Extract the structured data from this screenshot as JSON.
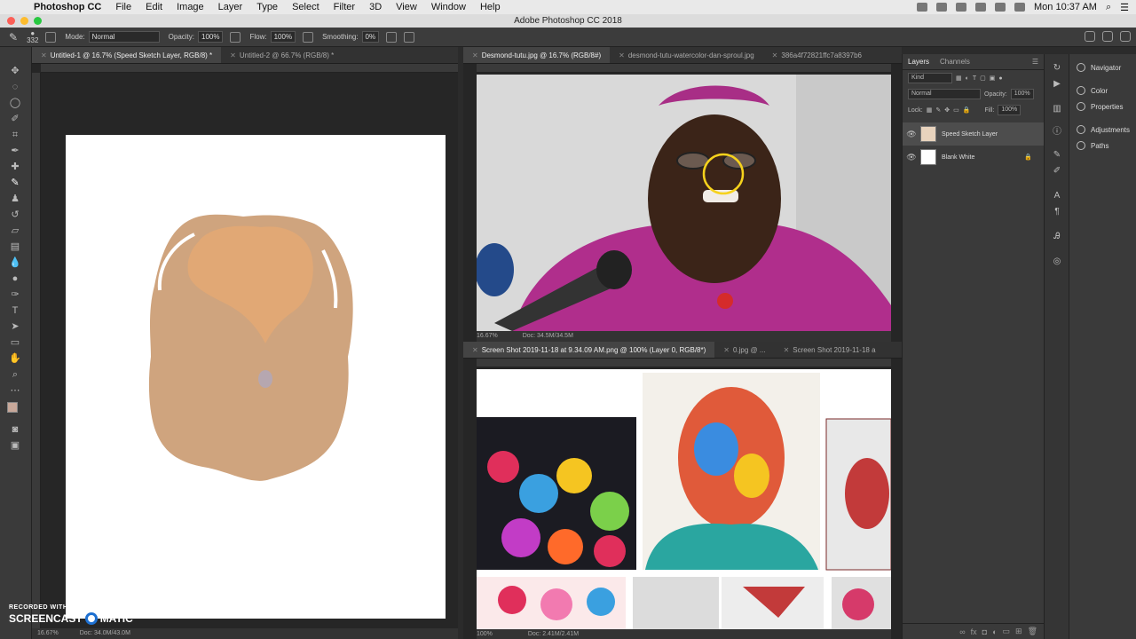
{
  "menubar": {
    "app_name": "Photoshop CC",
    "items": [
      "File",
      "Edit",
      "Image",
      "Layer",
      "Type",
      "Select",
      "Filter",
      "3D",
      "View",
      "Window",
      "Help"
    ],
    "clock": "Mon 10:37 AM"
  },
  "window": {
    "title": "Adobe Photoshop CC 2018"
  },
  "options": {
    "brush_size": "332",
    "mode_label": "Mode:",
    "mode_value": "Normal",
    "opacity_label": "Opacity:",
    "opacity_value": "100%",
    "flow_label": "Flow:",
    "flow_value": "100%",
    "smoothing_label": "Smoothing:",
    "smoothing_value": "0%"
  },
  "doc1": {
    "tabs": [
      "Untitled-1 @ 16.7% (Speed Sketch Layer, RGB/8) *",
      "Untitled-2 @ 66.7% (RGB/8) *"
    ],
    "zoom": "16.67%",
    "doc_info": "Doc: 34.0M/43.0M",
    "colors": {
      "sketch_dark": "#cfa47e",
      "sketch_light": "#e1a875"
    }
  },
  "doc2": {
    "tabs": [
      "Desmond-tutu.jpg @ 16.7% (RGB/8#)",
      "desmond-tutu-watercolor-dan-sproul.jpg",
      "386a4f72821ffc7a8397b6"
    ],
    "zoom": "16.67%",
    "doc_info": "Doc: 34.5M/34.5M"
  },
  "doc3": {
    "tabs": [
      "Screen Shot 2019-11-18 at 9.34.09 AM.png @ 100% (Layer 0, RGB/8*)",
      "0.jpg @ ...",
      "Screen Shot 2019-11-18 a"
    ],
    "zoom": "100%",
    "doc_info": "Doc: 2.41M/2.41M"
  },
  "layers": {
    "tabs": [
      "Layers",
      "Channels"
    ],
    "filter": "Kind",
    "blend": "Normal",
    "opacity_label": "Opacity:",
    "opacity_value": "100%",
    "lock_label": "Lock:",
    "fill_label": "Fill:",
    "fill_value": "100%",
    "items": [
      {
        "name": "Speed Sketch Layer"
      },
      {
        "name": "Blank White"
      }
    ]
  },
  "side_panels": [
    "Navigator",
    "Color",
    "Properties",
    "Adjustments",
    "Paths"
  ],
  "watermark": {
    "line1": "RECORDED WITH",
    "left": "SCREENCAST",
    "right": "MATIC"
  },
  "bottom_status": {
    "zoom": "16.67%",
    "doc_info": "Doc: 34.0M/43.0M"
  }
}
